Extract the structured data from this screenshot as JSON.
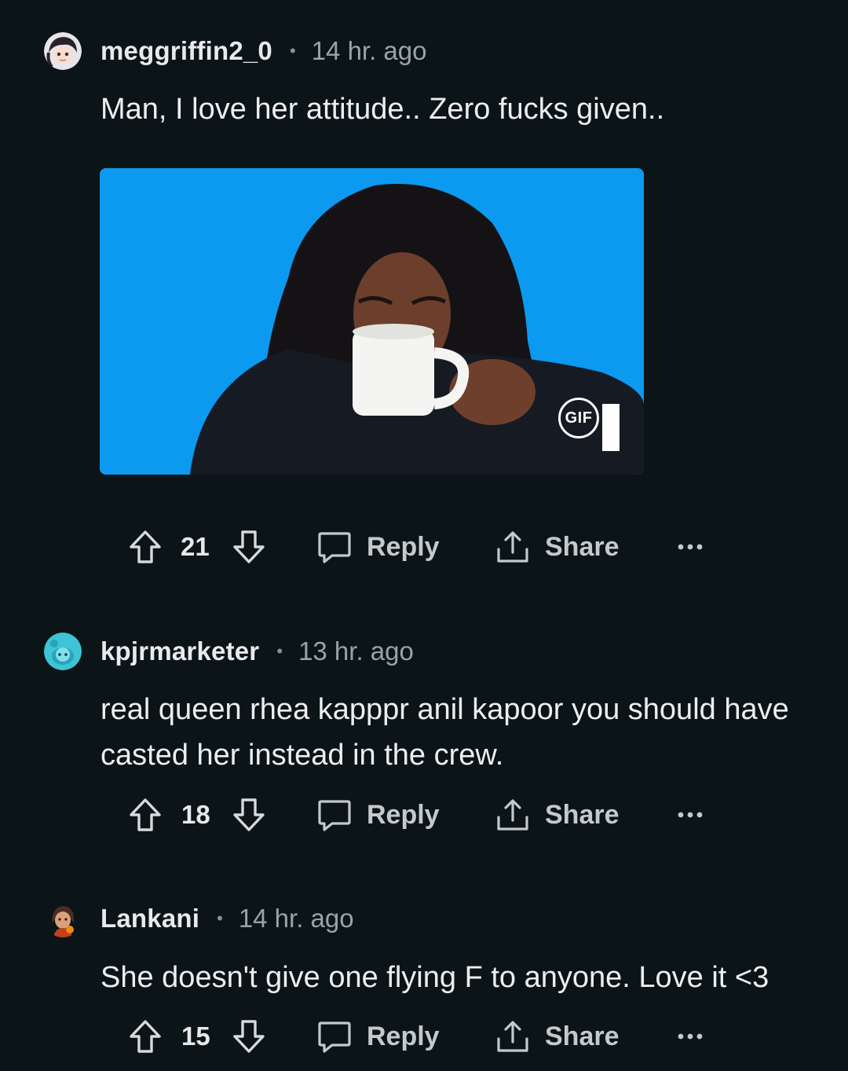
{
  "comments": [
    {
      "username": "meggriffin2_0",
      "time": "14 hr. ago",
      "text": "Man, I love her attitude.. Zero fucks given..",
      "gif_badge": "GIF",
      "votes": "21",
      "reply_label": "Reply",
      "share_label": "Share"
    },
    {
      "username": "kpjrmarketer",
      "time": "13 hr. ago",
      "text": "real queen rhea kapppr anil kapoor you should have casted her instead in the crew.",
      "votes": "18",
      "reply_label": "Reply",
      "share_label": "Share"
    },
    {
      "username": "Lankani",
      "time": "14 hr. ago",
      "text": "She doesn't give one flying F to anyone. Love it <3",
      "votes": "15",
      "reply_label": "Reply",
      "share_label": "Share"
    }
  ],
  "separator": "•",
  "colors": {
    "background": "#0b1416",
    "text": "#eceef0",
    "muted": "#9aa3a8",
    "gif_background": "#0b9af0"
  },
  "icons": [
    "upvote-icon",
    "downvote-icon",
    "reply-icon",
    "share-icon",
    "more-options-icon"
  ]
}
